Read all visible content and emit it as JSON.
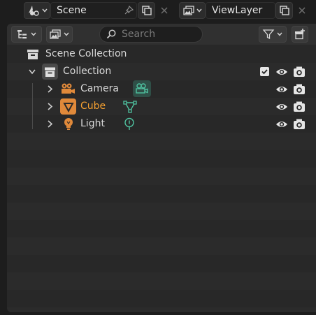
{
  "topbar": {
    "scene_label": "Scene",
    "view_layer_label": "ViewLayer",
    "icons": [
      "scene-icon",
      "pin-icon",
      "new-scene-icon",
      "close-icon",
      "render-layers-icon",
      "new-view-layer-icon"
    ]
  },
  "outliner": {
    "display_mode_icon": "outliner-tree-icon",
    "filter_icon": "funnel-icon",
    "search_placeholder": "Search",
    "new_collection_icon": "new-collection-icon",
    "tree": {
      "scene_collection": "Scene Collection",
      "collection": "Collection",
      "objects": [
        {
          "name": "Camera",
          "type": "camera",
          "data_icon": "camera-data-icon",
          "selected": false
        },
        {
          "name": "Cube",
          "type": "mesh",
          "data_icon": "mesh-data-icon",
          "selected": true
        },
        {
          "name": "Light",
          "type": "light",
          "data_icon": "light-data-icon",
          "selected": false
        }
      ]
    },
    "colors": {
      "active_object_text": "#f5a030",
      "object_icon": "#e0893a",
      "data_icon": "#4fc2a0",
      "text": "#d8d8d8"
    }
  }
}
